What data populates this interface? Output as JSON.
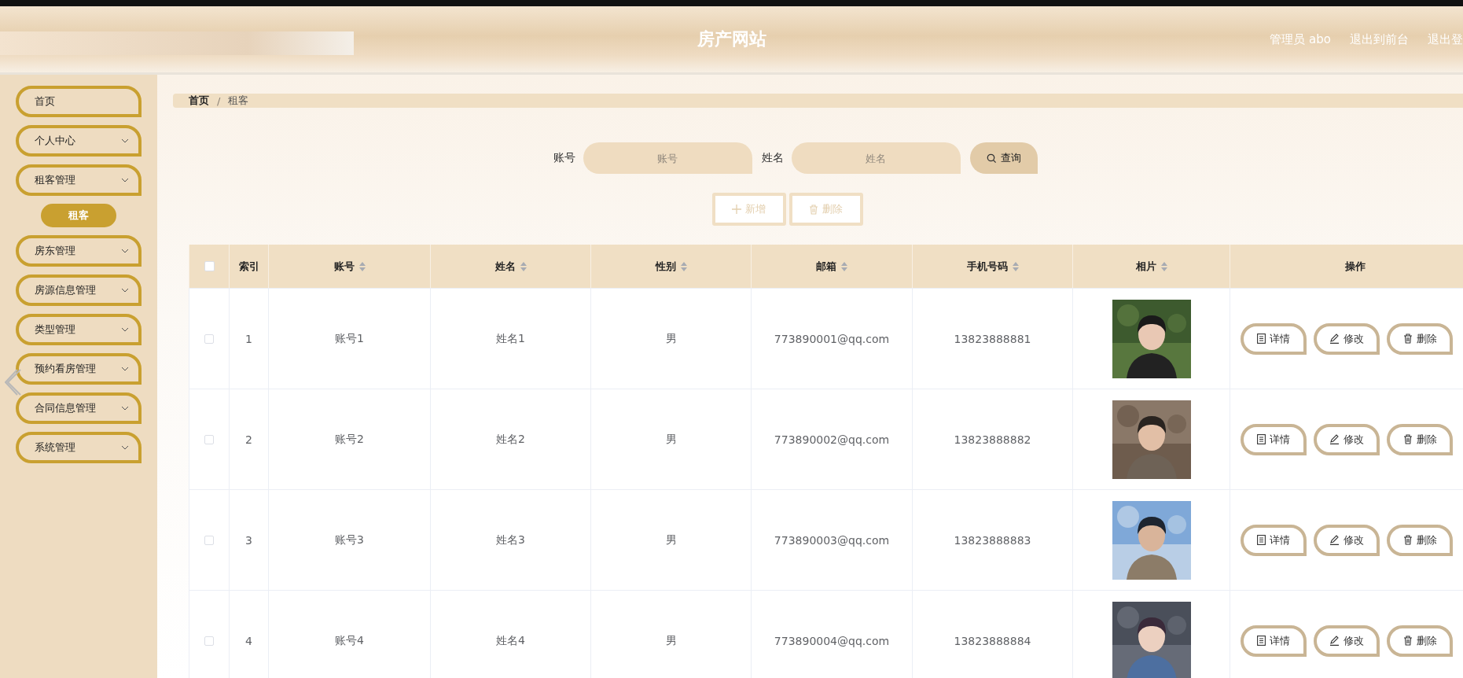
{
  "header": {
    "title": "房产网站",
    "links": [
      "管理员 abo",
      "退出到前台",
      "退出登"
    ]
  },
  "sidebar": {
    "items": [
      {
        "label": "首页",
        "kind": "link"
      },
      {
        "label": "个人中心",
        "kind": "submenu"
      },
      {
        "label": "租客管理",
        "kind": "submenu",
        "children": [
          {
            "label": "租客",
            "selected": true
          }
        ]
      },
      {
        "label": "房东管理",
        "kind": "submenu"
      },
      {
        "label": "房源信息管理",
        "kind": "submenu"
      },
      {
        "label": "类型管理",
        "kind": "submenu"
      },
      {
        "label": "预约看房管理",
        "kind": "submenu"
      },
      {
        "label": "合同信息管理",
        "kind": "submenu"
      },
      {
        "label": "系统管理",
        "kind": "submenu"
      }
    ]
  },
  "breadcrumb": {
    "separator": "/",
    "items": [
      "首页",
      "租客"
    ]
  },
  "search": {
    "fields": [
      {
        "label": "账号",
        "placeholder": "账号"
      },
      {
        "label": "姓名",
        "placeholder": "姓名"
      }
    ],
    "button": "查询"
  },
  "toolbar": [
    {
      "kind": "add",
      "label": "新增"
    },
    {
      "kind": "delete",
      "label": "删除"
    }
  ],
  "table": {
    "select_all": {
      "checked": false
    },
    "columns": [
      {
        "label": "索引",
        "sortable": false
      },
      {
        "label": "账号",
        "sortable": true
      },
      {
        "label": "姓名",
        "sortable": true
      },
      {
        "label": "性别",
        "sortable": true
      },
      {
        "label": "邮箱",
        "sortable": true
      },
      {
        "label": "手机号码",
        "sortable": true
      },
      {
        "label": "相片",
        "sortable": true
      },
      {
        "label": "操作",
        "sortable": false
      }
    ],
    "rows": [
      {
        "checked": false,
        "cells": [
          "1",
          "账号1",
          "姓名1",
          "男",
          "773890001@qq.com",
          "13823888881"
        ],
        "photo": {
          "kind": "picture"
        },
        "actions": [
          {
            "kind": "detail",
            "label": "详情"
          },
          {
            "kind": "edit",
            "label": "修改"
          },
          {
            "kind": "delete",
            "label": "删除"
          }
        ]
      },
      {
        "checked": false,
        "cells": [
          "2",
          "账号2",
          "姓名2",
          "男",
          "773890002@qq.com",
          "13823888882"
        ],
        "photo": {
          "kind": "picture"
        },
        "actions": [
          {
            "kind": "detail",
            "label": "详情"
          },
          {
            "kind": "edit",
            "label": "修改"
          },
          {
            "kind": "delete",
            "label": "删除"
          }
        ]
      },
      {
        "checked": false,
        "cells": [
          "3",
          "账号3",
          "姓名3",
          "男",
          "773890003@qq.com",
          "13823888883"
        ],
        "photo": {
          "kind": "picture"
        },
        "actions": [
          {
            "kind": "detail",
            "label": "详情"
          },
          {
            "kind": "edit",
            "label": "修改"
          },
          {
            "kind": "delete",
            "label": "删除"
          }
        ]
      },
      {
        "checked": false,
        "cells": [
          "4",
          "账号4",
          "姓名4",
          "男",
          "773890004@qq.com",
          "13823888884"
        ],
        "photo": {
          "kind": "picture"
        },
        "actions": [
          {
            "kind": "detail",
            "label": "详情"
          },
          {
            "kind": "edit",
            "label": "修改"
          },
          {
            "kind": "delete",
            "label": "删除"
          }
        ]
      }
    ]
  }
}
